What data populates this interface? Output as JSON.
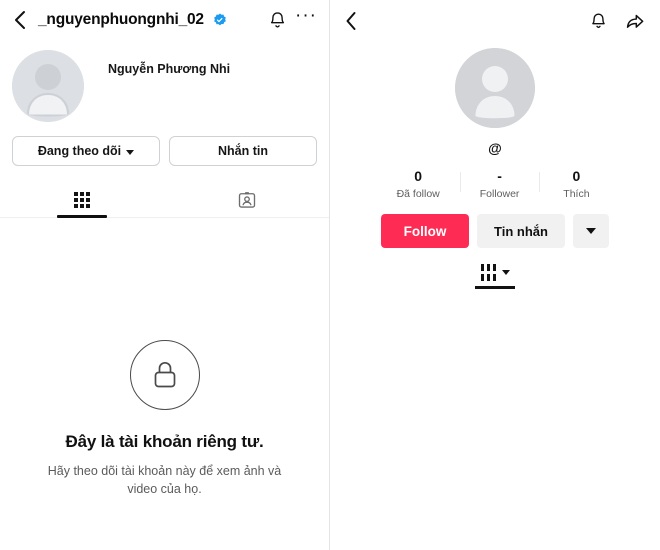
{
  "left_panel": {
    "header": {
      "back_icon": "chevron-left-icon",
      "username": "_nguyenphuongnhi_02",
      "verified_icon": "verified-badge-icon",
      "verified_color": "#1d9bf0",
      "bell_icon": "bell-icon",
      "more_icon": "more-options-icon",
      "more_label": "···"
    },
    "profile": {
      "avatar_icon": "default-avatar-icon",
      "full_name": "Nguyễn Phương Nhi"
    },
    "actions": {
      "following_label": "Đang theo dõi",
      "message_label": "Nhắn tin"
    },
    "tabs": [
      {
        "name": "grid",
        "icon": "grid-icon",
        "active": true
      },
      {
        "name": "tagged",
        "icon": "tagged-photos-icon",
        "active": false
      }
    ],
    "private": {
      "lock_icon": "lock-icon",
      "title": "Đây là tài khoản riêng tư.",
      "subtitle": "Hãy theo dõi tài khoản này để xem ảnh và video của họ."
    }
  },
  "right_panel": {
    "header": {
      "back_icon": "chevron-left-icon",
      "bell_icon": "bell-icon",
      "share_icon": "share-arrow-icon"
    },
    "profile": {
      "avatar_icon": "default-avatar-icon",
      "handle": "@"
    },
    "stats": [
      {
        "value": "0",
        "label": "Đã follow"
      },
      {
        "value": "-",
        "label": "Follower"
      },
      {
        "value": "0",
        "label": "Thích"
      }
    ],
    "actions": {
      "follow_label": "Follow",
      "follow_color": "#fe2c55",
      "message_label": "Tin nhắn",
      "more_icon": "chevron-down-icon"
    },
    "tabs": [
      {
        "name": "videos",
        "icon": "video-grid-icon",
        "active": true
      }
    ]
  }
}
